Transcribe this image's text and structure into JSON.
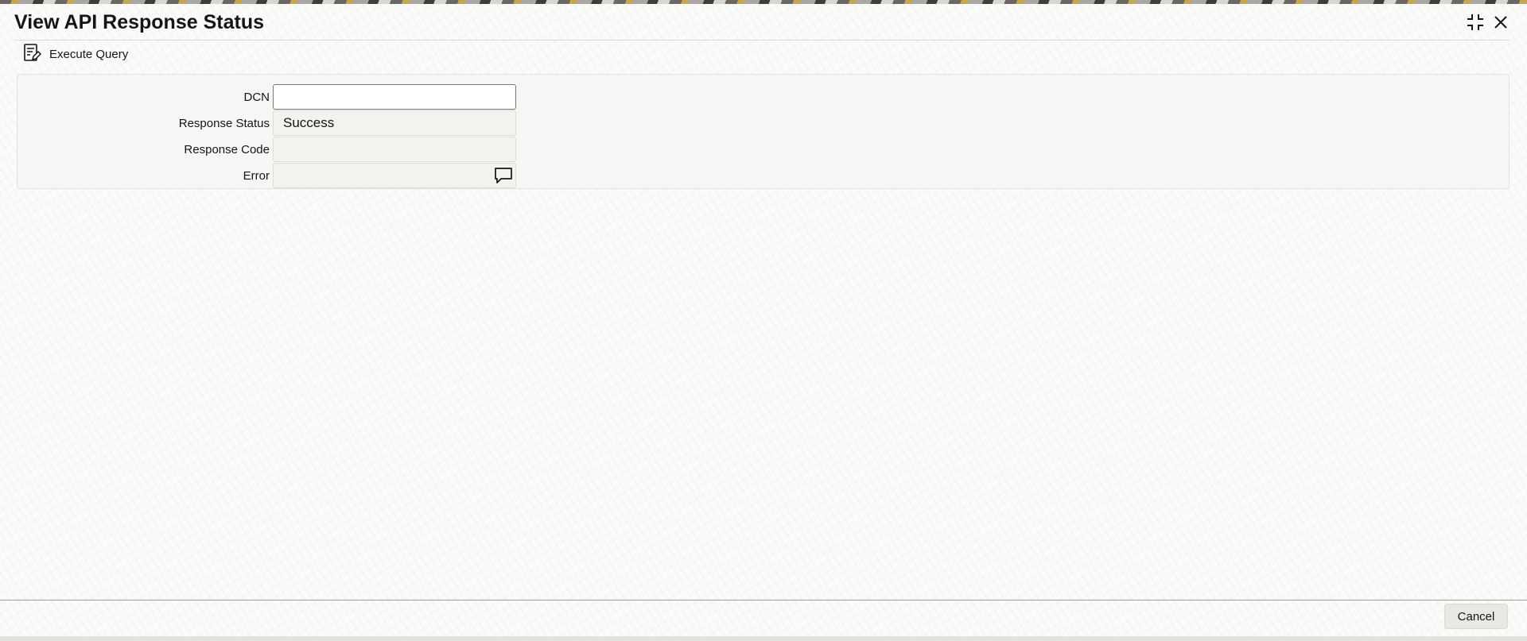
{
  "window": {
    "title": "View API Response Status",
    "minimize_icon": "collapse-arrows-icon",
    "close_icon": "close-icon"
  },
  "toolbar": {
    "execute_query_label": "Execute Query",
    "execute_query_icon": "query-document-icon"
  },
  "form": {
    "dcn": {
      "label": "DCN",
      "value": ""
    },
    "response_status": {
      "label": "Response Status",
      "value": "Success"
    },
    "response_code": {
      "label": "Response Code",
      "value": ""
    },
    "error": {
      "label": "Error",
      "value": "",
      "icon": "message-bubble-icon"
    }
  },
  "footer": {
    "cancel_label": "Cancel"
  }
}
